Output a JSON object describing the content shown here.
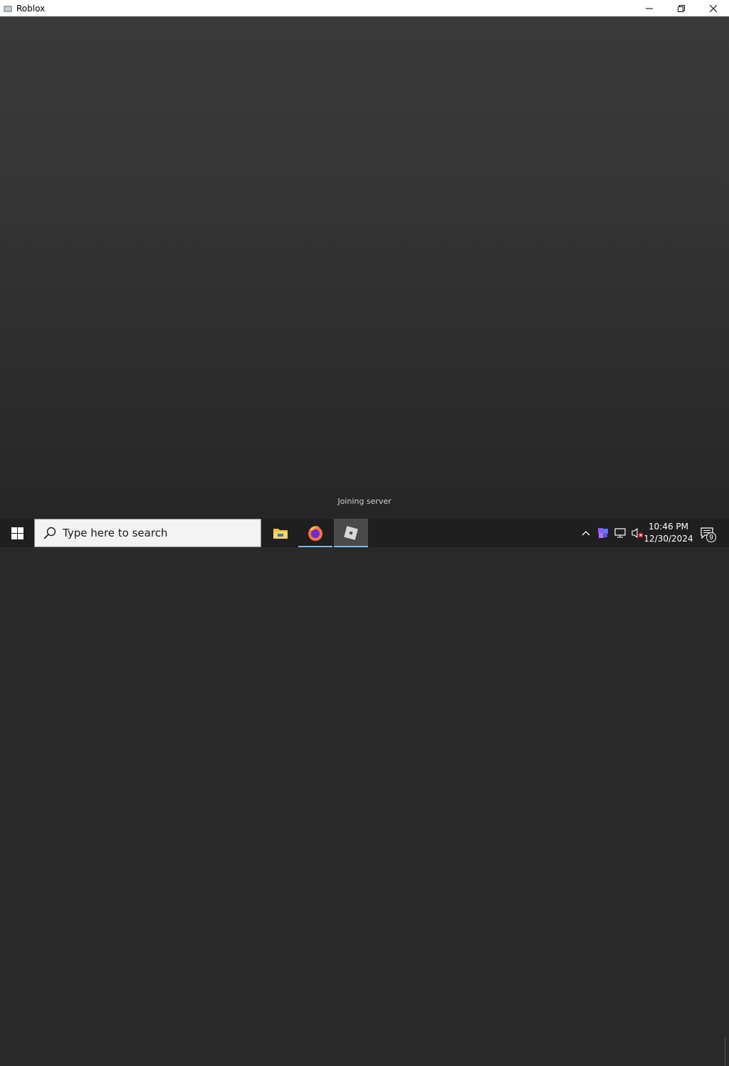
{
  "window": {
    "title": "Roblox"
  },
  "game": {
    "status_text": "Joining server"
  },
  "taskbar": {
    "search_placeholder": "Type here to search",
    "apps": [
      {
        "name": "File Explorer"
      },
      {
        "name": "Firefox"
      },
      {
        "name": "Roblox"
      }
    ],
    "clock": {
      "time": "10:46 PM",
      "date": "12/30/2024"
    },
    "notification_count": "9"
  },
  "colors": {
    "taskbar": "#1f1f1f",
    "accent_underline": "#76b9ed",
    "game_bg": "#333333"
  }
}
